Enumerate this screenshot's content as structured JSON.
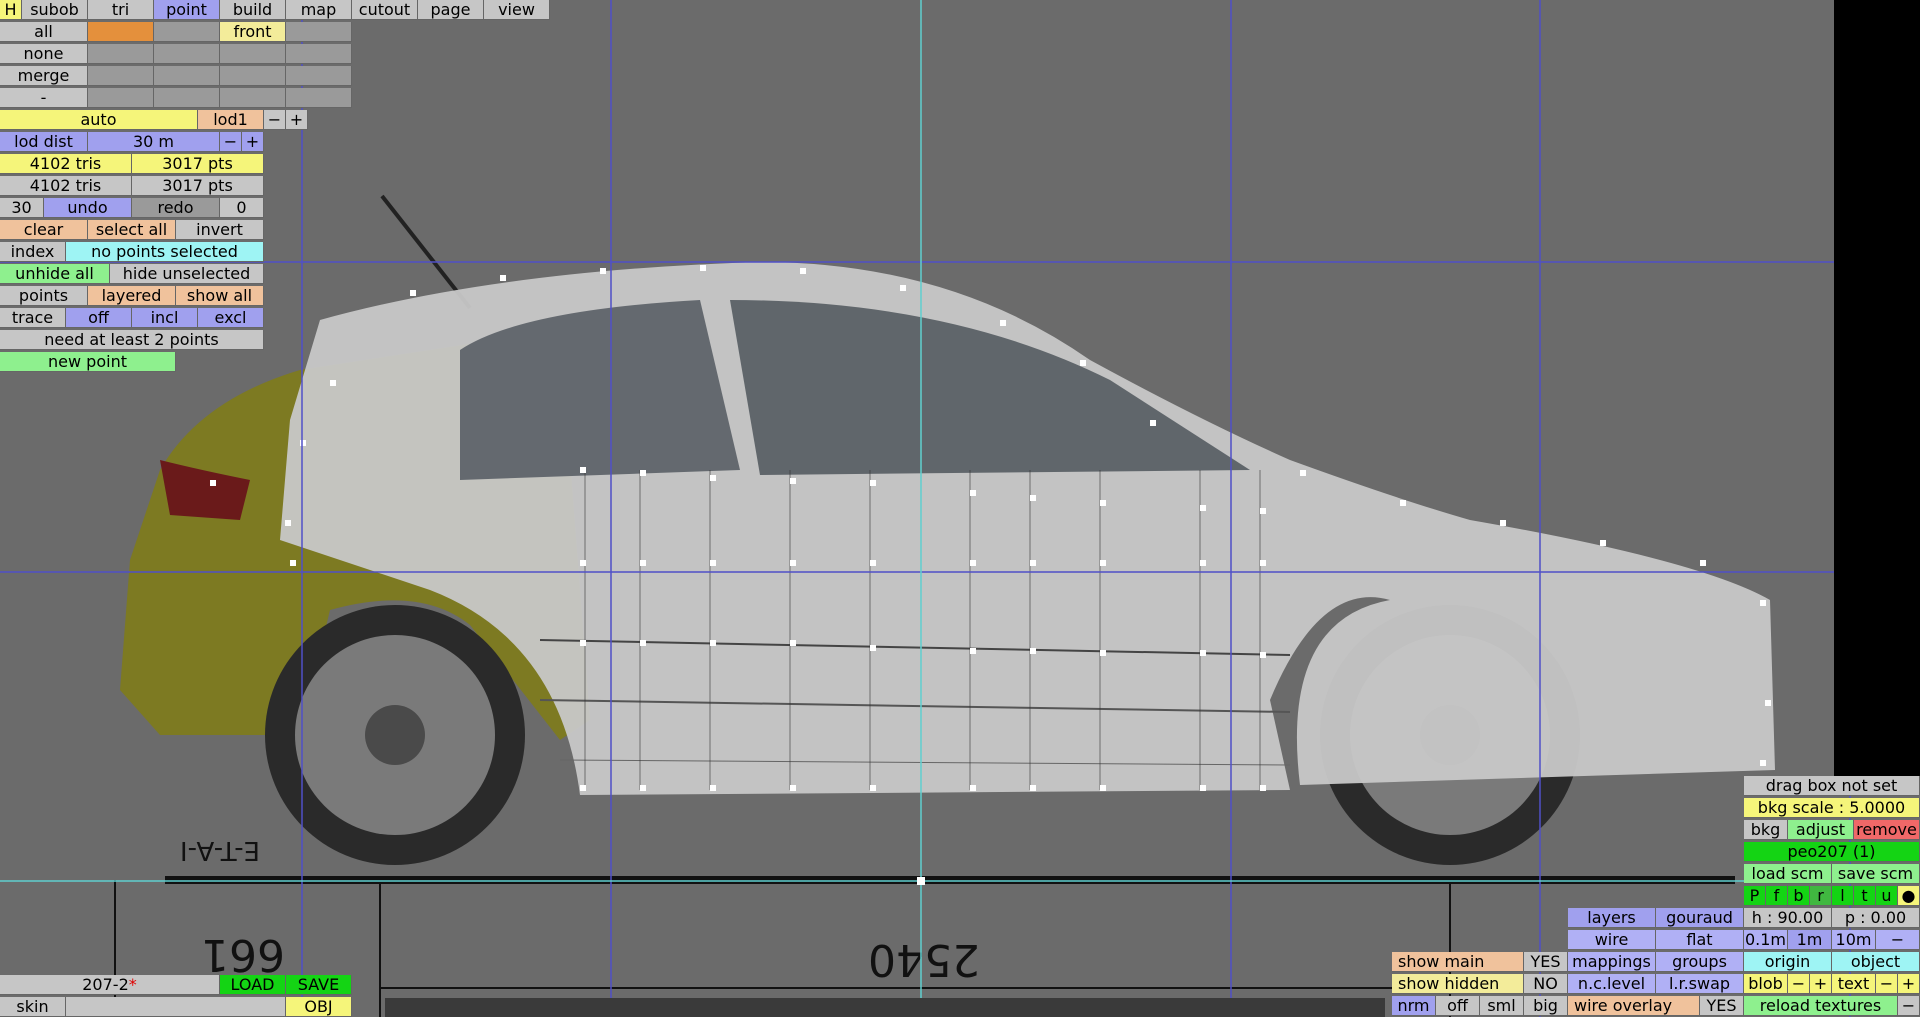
{
  "menu": {
    "h": "H",
    "tabs": [
      "subob",
      "tri",
      "point",
      "build",
      "map",
      "cutout",
      "page",
      "view"
    ]
  },
  "row_all": {
    "all": "all",
    "front": "front"
  },
  "row_none": "none",
  "row_merge": "merge",
  "row_dash": "-",
  "lod": {
    "auto": "auto",
    "lod": "lod1",
    "minus": "−",
    "plus": "+"
  },
  "loddist": {
    "label": "lod dist",
    "value": "30 m",
    "minus": "−",
    "plus": "+"
  },
  "stats1": {
    "tris": "4102 tris",
    "pts": "3017 pts"
  },
  "stats2": {
    "tris": "4102 tris",
    "pts": "3017 pts"
  },
  "undo": {
    "count": "30",
    "undo": "undo",
    "redo": "redo",
    "redo_count": "0"
  },
  "select": {
    "clear": "clear",
    "select_all": "select all",
    "invert": "invert"
  },
  "index": {
    "label": "index",
    "status": "no points selected"
  },
  "hide": {
    "unhide_all": "unhide all",
    "hide_unselected": "hide unselected"
  },
  "points_row": {
    "points": "points",
    "layered": "layered",
    "show_all": "show all"
  },
  "trace": {
    "trace": "trace",
    "off": "off",
    "incl": "incl",
    "excl": "excl"
  },
  "need": "need at least 2 points",
  "new_point": "new point",
  "file": {
    "name": "207-2",
    "modified": "*",
    "load": "LOAD",
    "save": "SAVE",
    "skin": "skin",
    "obj": "OBJ"
  },
  "right": {
    "drag_box": "drag box not set",
    "bkg_scale": "bkg scale : 5.0000",
    "bkg": "bkg",
    "adjust": "adjust",
    "remove": "remove",
    "model": "peo207 (1)",
    "load_scm": "load scm",
    "save_scm": "save scm",
    "views": [
      "P",
      "f",
      "b",
      "r",
      "l",
      "t",
      "u",
      "●"
    ],
    "h": "h : 90.00",
    "p": "p : 0.00",
    "steps": [
      "0.1m",
      "1m",
      "10m",
      "−"
    ],
    "origin": "origin",
    "object": "object",
    "blob": "blob",
    "text": "text",
    "minus": "−",
    "plus": "+",
    "reload": "reload textures",
    "reload_dash": "−"
  },
  "display": {
    "layers": "layers",
    "gouraud": "gouraud",
    "wire": "wire",
    "flat": "flat",
    "mappings": "mappings",
    "groups": "groups",
    "nclevel": "n.c.level",
    "lrswap": "l.r.swap",
    "show_main": "show main",
    "show_main_val": "YES",
    "show_hidden": "show hidden",
    "show_hidden_val": "NO",
    "wire_overlay": "wire overlay",
    "wire_overlay_val": "YES",
    "nrm": "nrm",
    "off": "off",
    "sml": "sml",
    "big": "big"
  },
  "blueprint": {
    "dim1": "661",
    "dim2": "2540",
    "code": "E-T-A-I"
  },
  "colors": {
    "body": "#a8a8a8",
    "yellow_car": "#7d7a22",
    "guide_blue": "#5050c8",
    "guide_cyan": "#60d0d0"
  }
}
